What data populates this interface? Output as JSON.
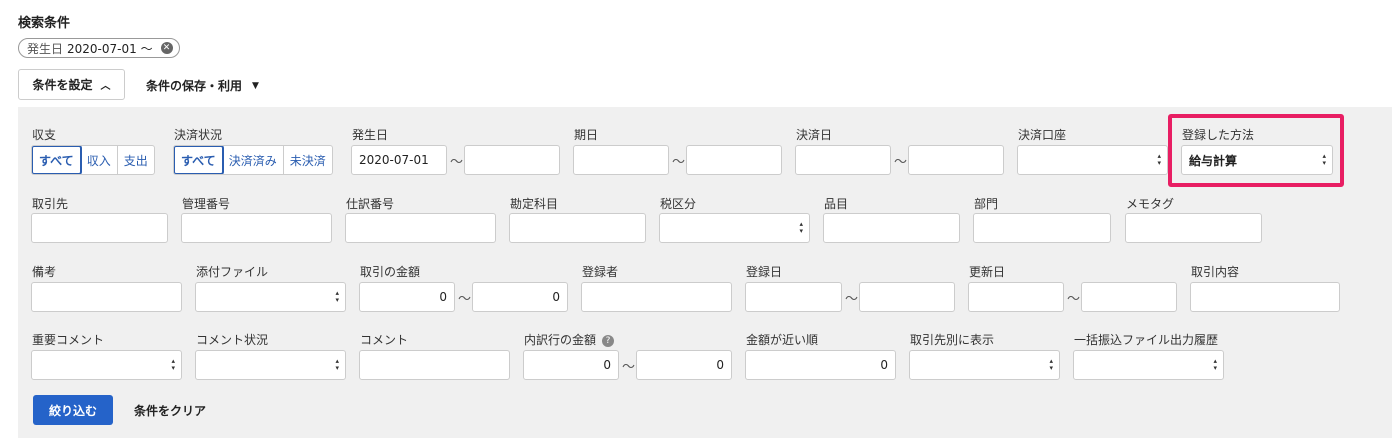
{
  "heading": "検索条件",
  "chip": {
    "tag": "発生日",
    "value": "2020-07-01 〜"
  },
  "set_condition_label": "条件を設定",
  "save_use_label": "条件の保存・利用",
  "tilde": "〜",
  "row1": {
    "income_label": "収支",
    "income_options": [
      "すべて",
      "収入",
      "支出"
    ],
    "settle_label": "決済状況",
    "settle_options": [
      "すべて",
      "決済済み",
      "未決済"
    ],
    "issue_label": "発生日",
    "issue_from": "2020-07-01",
    "due_label": "期日",
    "settle_date_label": "決済日",
    "account_label": "決済口座",
    "method_label": "登録した方法",
    "method_value": "給与計算"
  },
  "row2": {
    "partner_label": "取引先",
    "mgmt_label": "管理番号",
    "journal_label": "仕訳番号",
    "account_item_label": "勘定科目",
    "tax_label": "税区分",
    "item_label": "品目",
    "dept_label": "部門",
    "memo_label": "メモタグ"
  },
  "row3": {
    "remarks_label": "備考",
    "attach_label": "添付ファイル",
    "amount_label": "取引の金額",
    "amount_from": "0",
    "amount_to": "0",
    "registrant_label": "登録者",
    "reg_date_label": "登録日",
    "upd_date_label": "更新日",
    "content_label": "取引内容"
  },
  "row4": {
    "important_label": "重要コメント",
    "comment_status_label": "コメント状況",
    "comment_label": "コメント",
    "breakdown_label": "内訳行の金額",
    "breakdown_from": "0",
    "breakdown_to": "0",
    "near_label": "金額が近い順",
    "near_value": "0",
    "partner_display_label": "取引先別に表示",
    "bulk_label": "一括振込ファイル出力履歴"
  },
  "filter_button": "絞り込む",
  "clear_button": "条件をクリア"
}
